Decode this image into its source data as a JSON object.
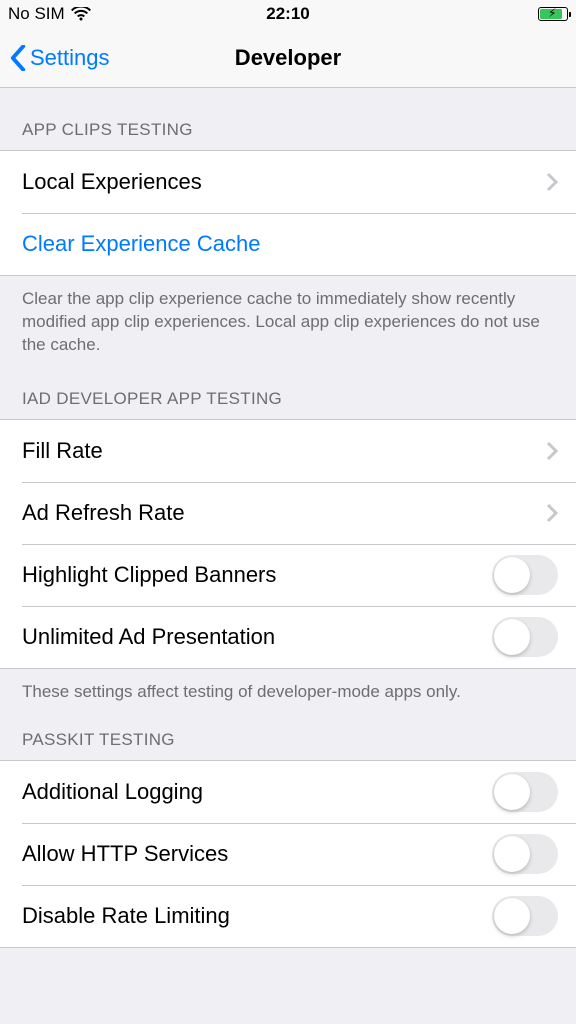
{
  "statusBar": {
    "carrier": "No SIM",
    "time": "22:10"
  },
  "nav": {
    "back": "Settings",
    "title": "Developer"
  },
  "sections": {
    "appClips": {
      "header": "APP CLIPS TESTING",
      "row0": "Local Experiences",
      "row1": "Clear Experience Cache",
      "footer": "Clear the app clip experience cache to immediately show recently modified app clip experiences. Local app clip experiences do not use the cache."
    },
    "iad": {
      "header": "IAD DEVELOPER APP TESTING",
      "row0": "Fill Rate",
      "row1": "Ad Refresh Rate",
      "row2": "Highlight Clipped Banners",
      "row3": "Unlimited Ad Presentation",
      "footer": "These settings affect testing of developer-mode apps only."
    },
    "passkit": {
      "header": "PASSKIT TESTING",
      "row0": "Additional Logging",
      "row1": "Allow HTTP Services",
      "row2": "Disable Rate Limiting"
    }
  }
}
